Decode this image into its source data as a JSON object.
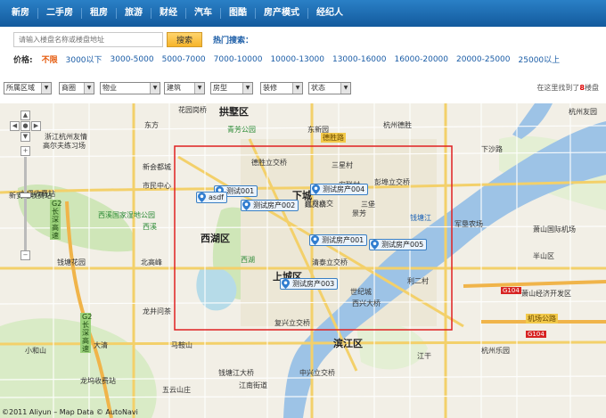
{
  "nav": {
    "items": [
      "新房",
      "二手房",
      "租房",
      "旅游",
      "财经",
      "汽车",
      "图酷",
      "房产模式",
      "经纪人"
    ]
  },
  "search": {
    "placeholder": "请输入楼盘名称或楼盘地址",
    "button": "搜索",
    "hot_label": "热门搜索："
  },
  "price": {
    "label": "价格:",
    "options": [
      "不限",
      "3000以下",
      "3000-5000",
      "5000-7000",
      "7000-10000",
      "10000-13000",
      "13000-16000",
      "16000-20000",
      "20000-25000",
      "25000以上"
    ],
    "selected": "不限"
  },
  "filters": [
    "所属区域",
    "商圈",
    "物业",
    "建筑",
    "房型",
    "装修",
    "状态"
  ],
  "found": {
    "prefix": "在这里找到了",
    "count": "8",
    "suffix": "楼盘"
  },
  "map": {
    "markers": [
      "测试001",
      "asdf",
      "测试房产002",
      "测试房产004",
      "测试房产001",
      "测试房产005",
      "测试房产003"
    ],
    "districts": [
      "拱墅区",
      "下城",
      "西湖区",
      "上城区",
      "滨江区"
    ],
    "places": [
      "花园岗桥",
      "德胜立交桥",
      "彭埠立交桥",
      "红交桥",
      "清泰立交桥",
      "复兴立交桥",
      "中兴立交桥",
      "钱塘江大桥",
      "钱塘江",
      "东方",
      "青芳公园",
      "东新园",
      "杭州德胜",
      "三星村",
      "新会都城",
      "市民中心",
      "浙江杭州友情",
      "高尔夫练习场",
      "九堡收费站",
      "西溪国家湿地公园",
      "西湖",
      "西溪",
      "钱塘花园",
      "北高峰",
      "龙井问茶",
      "凯月立交",
      "景芳",
      "安联村",
      "军垦农场",
      "萧山国际机场",
      "萧山经济开发区",
      "杭州乐园",
      "马鞍山",
      "大清",
      "小和山",
      "龙坞收费站",
      "五云山庄",
      "江南街道",
      "下沙路",
      "新安江收费站",
      "世纪城",
      "西兴大桥",
      "江干",
      "利二村",
      "三堡",
      "杭州友园",
      "德胜路",
      "半山区"
    ],
    "highways": [
      "G2 长深高速",
      "G2 长深高速",
      "G104",
      "G104",
      "机场公路"
    ],
    "copyright": "©2011 Aliyun – Map Data © AutoNavi"
  }
}
